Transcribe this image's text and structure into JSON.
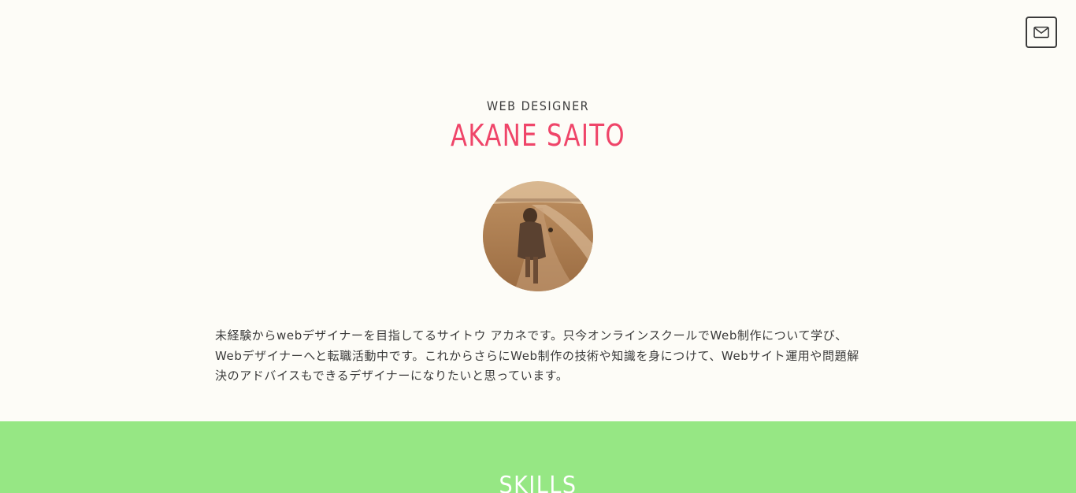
{
  "header": {
    "contact_icon": "mail-icon"
  },
  "hero": {
    "role": "WEB DESIGNER",
    "name": "AKANE SAITO",
    "bio": "未経験からwebデザイナーを目指してるサイトウ アカネです。只今オンラインスクールでWeb制作について学び、Webデザイナーへと転職活動中です。これからさらにWeb制作の技術や知識を身につけて、Webサイト運用や問題解決のアドバイスもできるデザイナーになりたいと思っています。"
  },
  "skills": {
    "title": "SKILLS"
  },
  "colors": {
    "background": "#fdfcf7",
    "accent": "#ef4569",
    "skills_band": "#96e784"
  }
}
